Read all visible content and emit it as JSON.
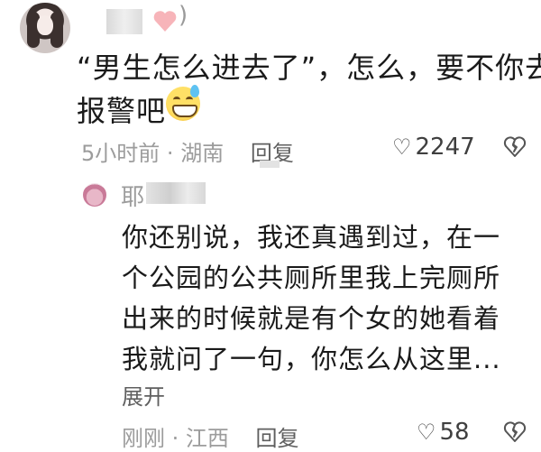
{
  "top_comment": {
    "text_line1": "“男生怎么进去了”，怎么，要不你去",
    "text_line2": "报警吧",
    "time": "5小时前",
    "location": "湖南",
    "reply_label": "回复",
    "likes": "2247",
    "paren": ")"
  },
  "reply": {
    "name_visible": "耶",
    "lines": [
      "你还别说，我还真遇到过，在一",
      "个公园的公共厕所里我上完厕所",
      "出来的时候就是有个女的她看着",
      "我就问了一句，你怎么从这里..."
    ],
    "expand_label": "展开",
    "time": "刚刚",
    "location": "江西",
    "reply_label": "回复",
    "likes": "58"
  },
  "icons": {
    "like": "heart-outline-icon",
    "dislike": "broken-heart-icon",
    "badge": "pink-heart-icon",
    "emoji": "grinning-sweat-emoji"
  },
  "colors": {
    "text": "#1a1a1a",
    "meta": "#9c9c9c",
    "badge_pink": "#f7b4b9"
  }
}
